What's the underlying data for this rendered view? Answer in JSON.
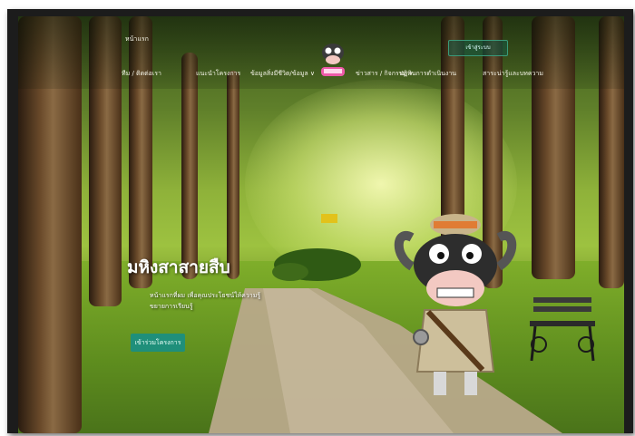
{
  "nav": {
    "home": "หน้าแรก",
    "cta": "เข้าสู่ระบบ",
    "items": [
      "ทีม / ติดต่อเรา",
      "แนะนำโครงการ",
      "ข้อมูลสิ่งมีชีวิต/ข้อมูล ∨",
      "ข่าวสาร / กิจกรรม ∨",
      "ปฏิทินการดำเนินงาน",
      "สาระน่ารู้และบทความ"
    ]
  },
  "hero": {
    "title": "มหิงสาสายสืบ",
    "subtitle": "หน้าแรกที่ผม เพื่อคุณประโยชน์ให้ความรู้ ขยายการเรียนรู้",
    "button": "เข้าร่วมโครงการ"
  }
}
